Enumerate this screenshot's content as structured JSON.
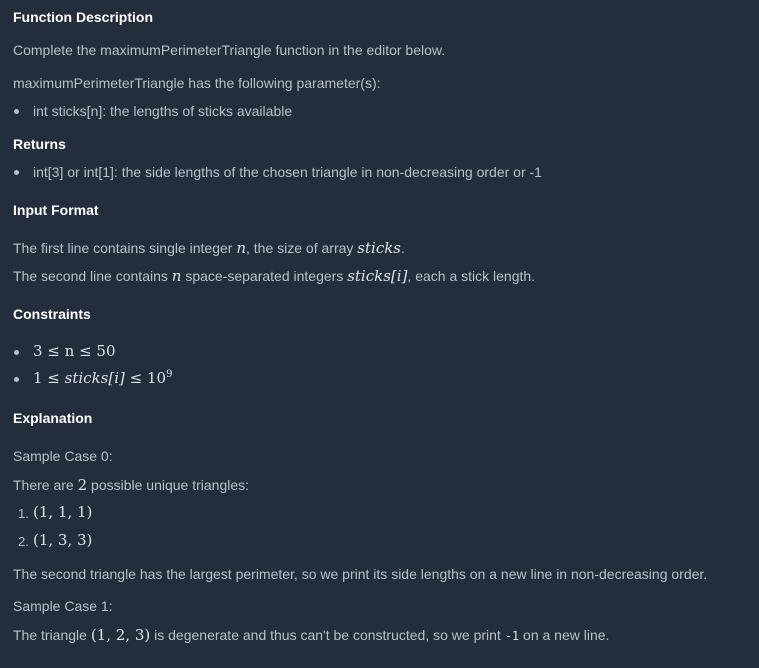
{
  "function_description": {
    "heading": "Function Description",
    "line1": "Complete the maximumPerimeterTriangle function in the editor below.",
    "line2": "maximumPerimeterTriangle has the following parameter(s):",
    "param": "int sticks[n]: the lengths of sticks available"
  },
  "returns": {
    "heading": "Returns",
    "item": "int[3] or int[1]: the side lengths of the chosen triangle in non-decreasing order or -1"
  },
  "input_format": {
    "heading": "Input Format",
    "l1_a": "The first line contains single integer ",
    "l1_n": "n",
    "l1_b": ", the size of array ",
    "l1_arr": "sticks",
    "l1_c": ".",
    "l2_a": "The second line contains ",
    "l2_n": "n",
    "l2_b": " space-separated integers ",
    "l2_arr": "sticks[i]",
    "l2_c": ", each a stick length."
  },
  "constraints": {
    "heading": "Constraints",
    "c1": "3 ≤ n ≤ 50",
    "c2_a": "1 ≤ ",
    "c2_b": "sticks[i]",
    "c2_c": " ≤ 10",
    "c2_exp": "9"
  },
  "explanation": {
    "heading": "Explanation",
    "case0": "Sample Case 0:",
    "there_a": "There are ",
    "there_n": "2",
    "there_b": " possible unique triangles:",
    "tri1_num": "1.",
    "tri1": "(1, 1, 1)",
    "tri2_num": "2.",
    "tri2": "(1, 3, 3)",
    "second": "The second triangle has the largest perimeter, so we print its side lengths on a new line in non-decreasing order.",
    "case1": "Sample Case 1:",
    "deg_a": "The triangle ",
    "deg_tri": "(1, 2, 3)",
    "deg_b": " is degenerate and thus can't be constructed, so we print ",
    "deg_code": "-1",
    "deg_c": " on a new line."
  }
}
